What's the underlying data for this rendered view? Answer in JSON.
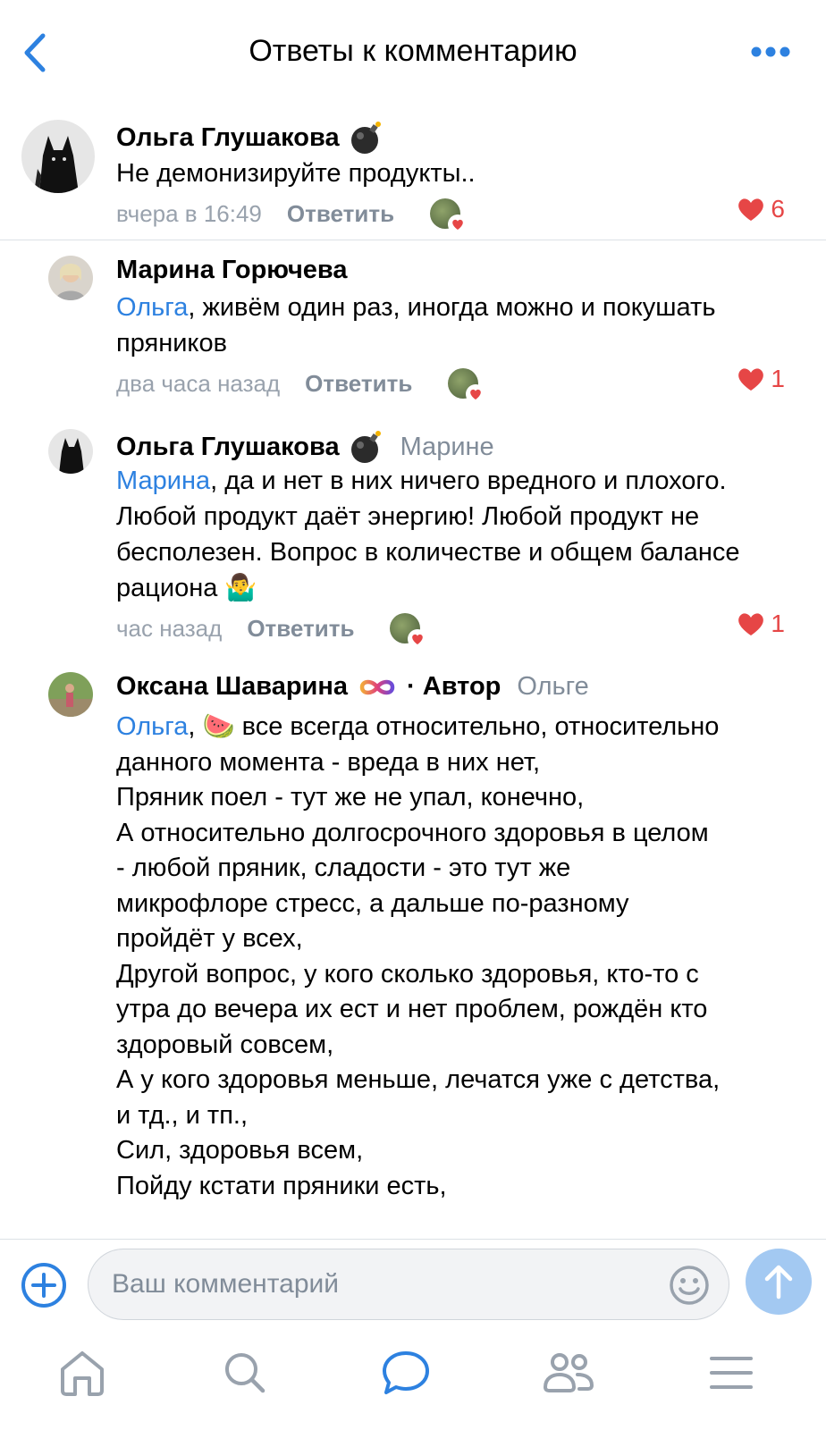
{
  "header": {
    "title": "Ответы к комментарию"
  },
  "comments": [
    {
      "author": "Ольга Глушакова",
      "badge_icon": "bomb-icon",
      "reply_to": "",
      "mention": "",
      "text": "Не демонизируйте продукты..",
      "time": "вчера в 16:49",
      "reply_label": "Ответить",
      "likes": "6"
    },
    {
      "author": "Марина Горючева",
      "reply_to": "",
      "mention": "Ольга",
      "text": ", живём один раз, иногда можно и покушать пряников",
      "time": "два часа назад",
      "reply_label": "Ответить",
      "likes": "1"
    },
    {
      "author": "Ольга Глушакова",
      "badge_icon": "bomb-icon",
      "reply_to": "Марине",
      "mention": "Марина",
      "text": ", да и нет в них ничего вредного и плохого. Любой продукт даёт энергию! Любой продукт не бесполезен. Вопрос в количестве и общем балансе рациона",
      "emoji": "🤷‍♂️",
      "time": "час назад",
      "reply_label": "Ответить",
      "likes": "1"
    },
    {
      "author": "Оксана Шаварина",
      "badge_icon": "infinity-icon",
      "author_label": "· Автор",
      "reply_to": "Ольге",
      "mention": "Ольга",
      "emoji": "🍉",
      "lines": [
        "все всегда относительно, относительно",
        "данного момента - вреда в них нет,",
        "Пряник поел - тут же не упал, конечно,",
        "А относительно долгосрочного здоровья в целом",
        "- любой пряник, сладости - это тут же",
        "микрофлоре стресс, а дальше по-разному",
        "пройдёт у всех,",
        "Другой вопрос, у кого сколько здоровья, кто-то с",
        "утра до вечера их ест и нет проблем, рождён кто",
        "здоровый совсем,",
        "А у кого здоровья меньше, лечатся уже с детства,",
        "и тд., и тп.,",
        "Сил, здоровья всем,",
        "Пойду кстати пряники есть,"
      ]
    }
  ],
  "composer": {
    "placeholder": "Ваш комментарий"
  },
  "tabbar": [
    "home-icon",
    "search-icon",
    "messages-icon",
    "friends-icon",
    "menu-icon"
  ],
  "colors": {
    "accent": "#2d81e0",
    "like": "#e64646",
    "meta": "#99a2ad",
    "send_disabled": "#a3c9f2"
  }
}
